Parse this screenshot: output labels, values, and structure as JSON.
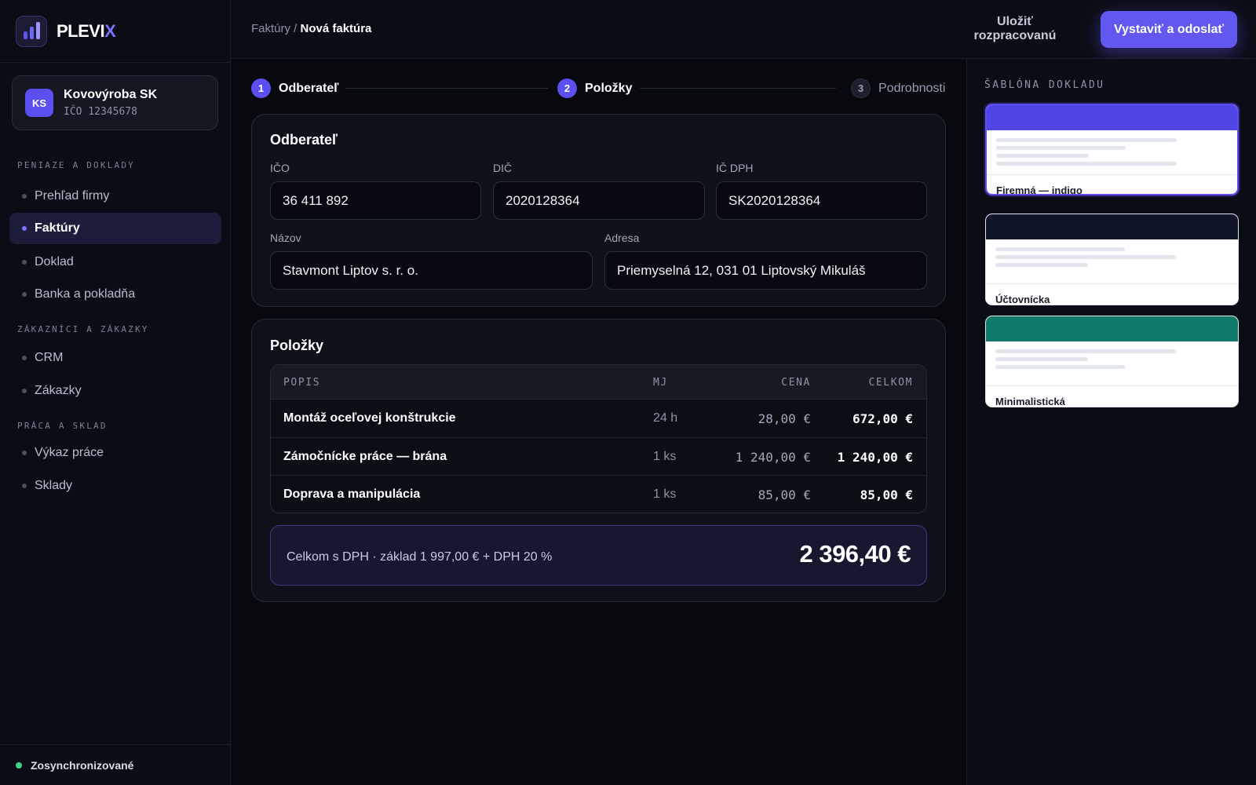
{
  "brand": {
    "name_main": "PLEVI",
    "name_accent": "X"
  },
  "company": {
    "initials": "KS",
    "name": "Kovovýroba SK",
    "id": "IČO 12345678"
  },
  "nav": {
    "sections": [
      {
        "title": "PENIAZE A DOKLADY"
      },
      {
        "title": "ZÁKAZNÍCI A ZÁKAZKY"
      },
      {
        "title": "PRÁCA A SKLAD"
      }
    ],
    "items": [
      {
        "label": "Prehľad firmy"
      },
      {
        "label": "Faktúry"
      },
      {
        "label": "Doklad"
      },
      {
        "label": "Banka a pokladňa"
      },
      {
        "label": "CRM"
      },
      {
        "label": "Zákazky"
      },
      {
        "label": "Výkaz práce"
      },
      {
        "label": "Sklady"
      }
    ],
    "active_item": "Faktúry"
  },
  "status": {
    "sync_label": "Zosynchronizované",
    "sync_color": "#3fd08a"
  },
  "header": {
    "breadcrumb_parent": "Faktúry /",
    "breadcrumb_current": "Nová faktúra",
    "save_draft_label": "Uložiť rozpracovanú",
    "send_label": "Vystaviť a odoslať"
  },
  "stepper": {
    "steps": [
      {
        "num": "1",
        "label": "Odberateľ",
        "state": "active"
      },
      {
        "num": "2",
        "label": "Položky",
        "state": "active"
      },
      {
        "num": "3",
        "label": "Podrobnosti",
        "state": "inactive"
      }
    ]
  },
  "customer": {
    "title": "Odberateľ",
    "ico_label": "IČO",
    "ico_value": "36 411 892",
    "dic_label": "DIČ",
    "dic_value": "2020128364",
    "icdph_label": "IČ DPH",
    "icdph_value": "SK2020128364",
    "name_label": "Názov",
    "name_value": "Stavmont Liptov s. r. o.",
    "address_label": "Adresa",
    "address_value": "Priemyselná 12, 031 01 Liptovský Mikuláš"
  },
  "items": {
    "title": "Položky",
    "columns": {
      "desc": "POPIS",
      "unit": "MJ",
      "price": "CENA",
      "total": "CELKOM"
    },
    "rows": [
      {
        "desc": "Montáž oceľovej konštrukcie",
        "unit": "24 h",
        "price": "28,00 €",
        "total": "672,00 €"
      },
      {
        "desc": "Zámočnícke práce — brána",
        "unit": "1 ks",
        "price": "1 240,00 €",
        "total": "1 240,00 €"
      },
      {
        "desc": "Doprava a manipulácia",
        "unit": "1 ks",
        "price": "85,00 €",
        "total": "85,00 €"
      }
    ],
    "summary_text": "Celkom s DPH · základ 1 997,00 € + DPH 20 %",
    "summary_amount": "2 396,40 €"
  },
  "templates": {
    "title": "ŠABLÓNA DOKLADU",
    "options": [
      {
        "label": "Firemná — indigo",
        "color": "#5046e5",
        "selected": true
      },
      {
        "label": "Účtovnícka",
        "color": "#0f1628",
        "selected": false
      },
      {
        "label": "Minimalistická",
        "color": "#0f7a6a",
        "selected": false
      }
    ]
  },
  "colors": {
    "accent": "#5b4ff0",
    "background": "#08090f"
  }
}
